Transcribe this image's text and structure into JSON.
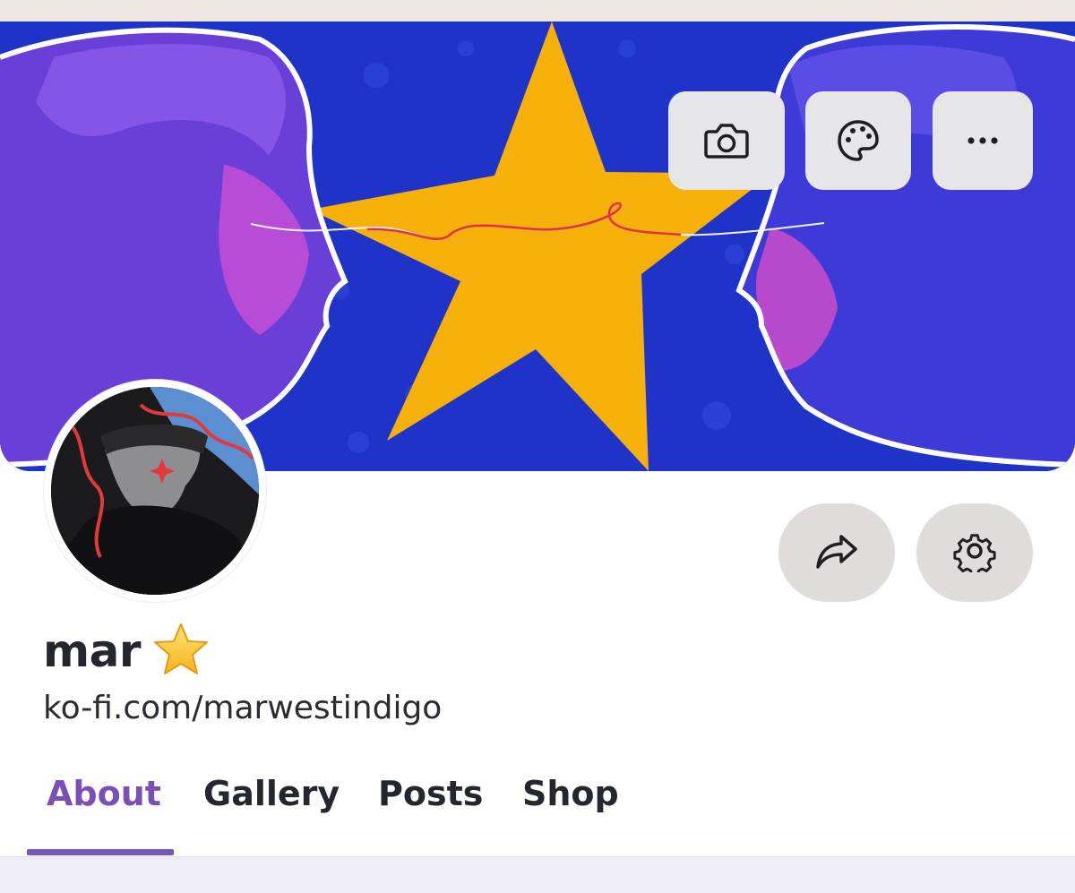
{
  "profile": {
    "name": "mar",
    "url": "ko-fi.com/marwestindigo"
  },
  "banner_actions": [
    {
      "icon": "camera-icon"
    },
    {
      "icon": "palette-icon"
    },
    {
      "icon": "more-icon"
    }
  ],
  "profile_actions": [
    {
      "icon": "share-icon"
    },
    {
      "icon": "settings-icon"
    }
  ],
  "tabs": [
    {
      "label": "About",
      "active": true
    },
    {
      "label": "Gallery",
      "active": false
    },
    {
      "label": "Posts",
      "active": false
    },
    {
      "label": "Shop",
      "active": false
    }
  ],
  "colors": {
    "accent": "#7b55c2",
    "banner_blue": "#1f33c9",
    "star_yellow": "#f5b10a",
    "button_bg": "#e6e6e8",
    "circle_button_bg": "#e1dcdc"
  }
}
